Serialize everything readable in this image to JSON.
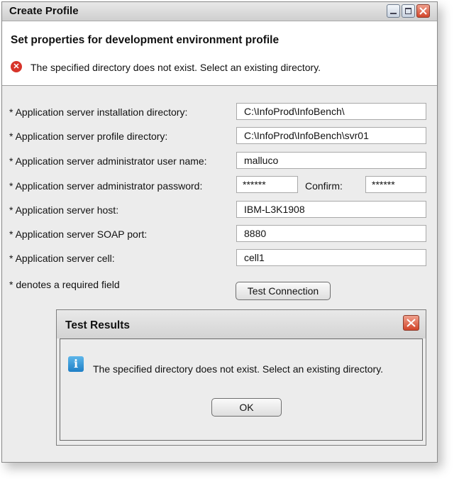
{
  "window": {
    "title": "Create Profile"
  },
  "header": {
    "heading": "Set properties for development environment profile",
    "error_message": "The specified directory does not exist. Select an existing directory.",
    "error_icon": "error-x-icon",
    "error_color": "#d7342a"
  },
  "form": {
    "install_dir": {
      "label": "* Application server installation directory:",
      "value": "C:\\InfoProd\\InfoBench\\"
    },
    "profile_dir": {
      "label": "* Application server profile directory:",
      "value": "C:\\InfoProd\\InfoBench\\svr01"
    },
    "admin_user": {
      "label": "* Application server administrator user name:",
      "value": "malluco"
    },
    "admin_password": {
      "label": "* Application server administrator password:",
      "value": "******"
    },
    "confirm": {
      "label": "Confirm:",
      "value": "******"
    },
    "host": {
      "label": "* Application server host:",
      "value": "IBM-L3K1908"
    },
    "soap_port": {
      "label": "* Application server SOAP port:",
      "value": "8880"
    },
    "cell": {
      "label": "* Application server cell:",
      "value": "cell1"
    },
    "required_note": "* denotes a required field",
    "test_connection_label": "Test Connection"
  },
  "dialog": {
    "title": "Test Results",
    "message": "The specified directory does not exist. Select an existing directory.",
    "ok_label": "OK",
    "info_icon": "info-icon",
    "info_glyph": "i"
  }
}
